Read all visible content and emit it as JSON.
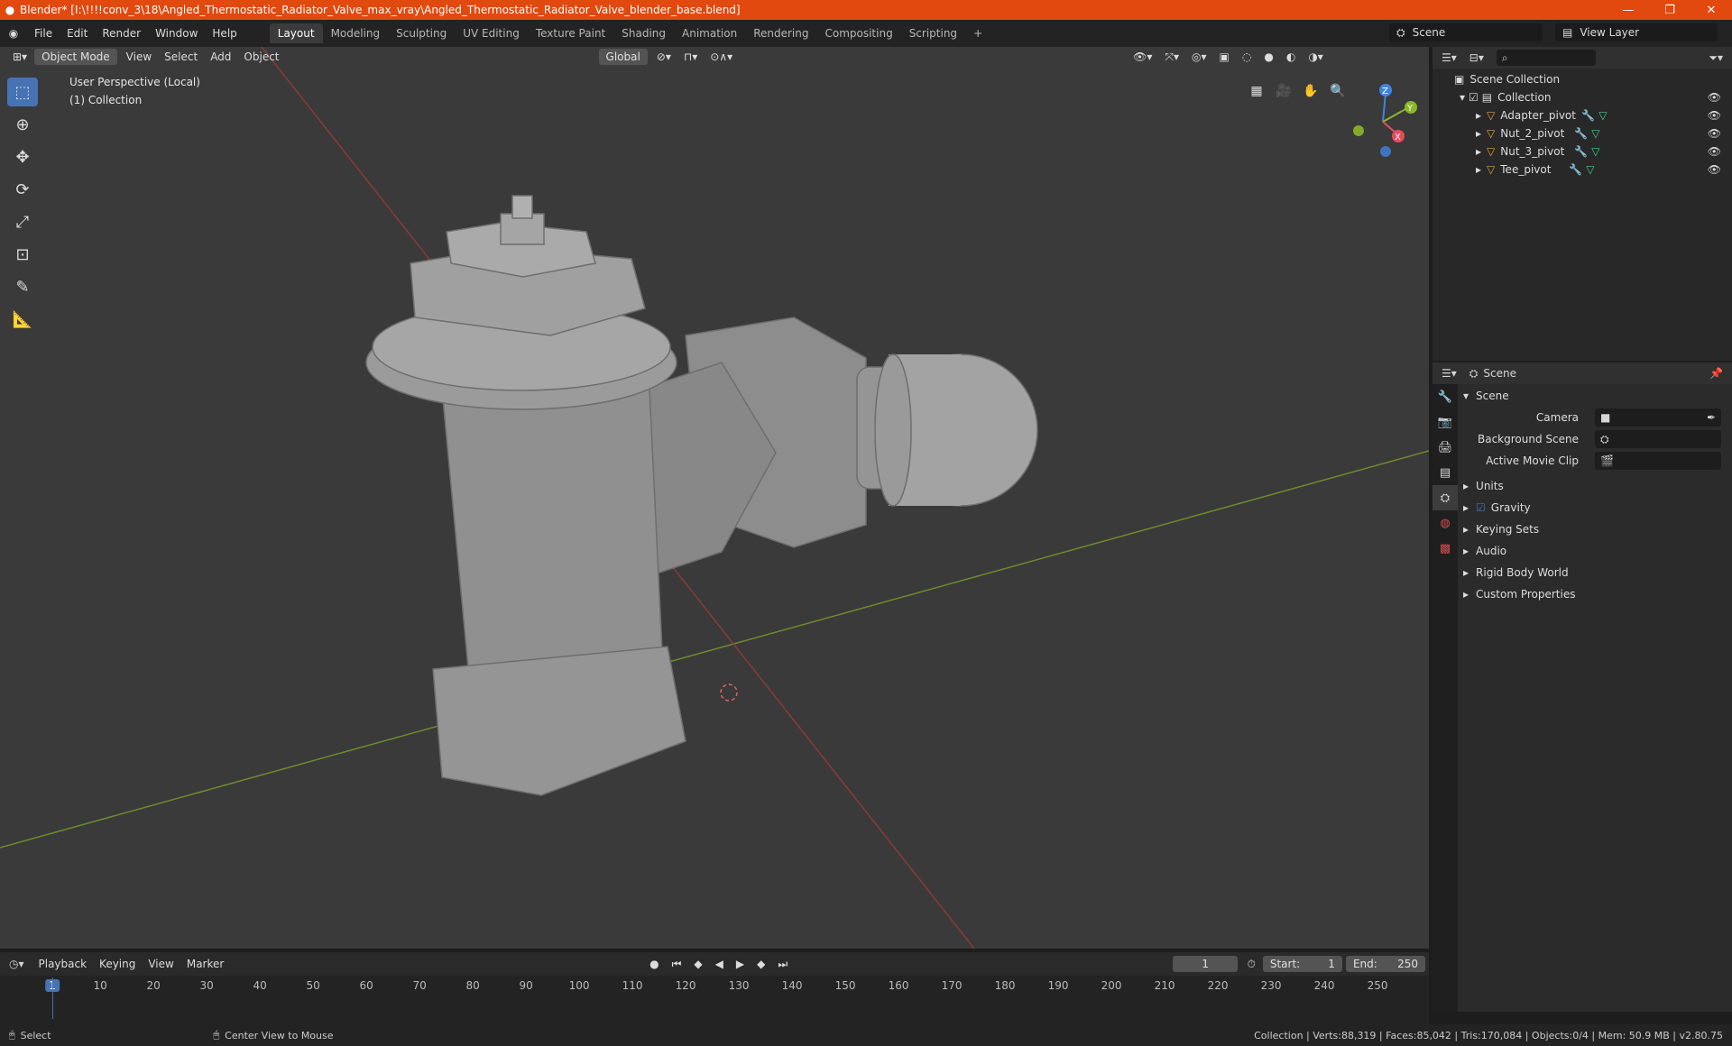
{
  "title": "Blender* [I:\\!!!!conv_3\\18\\Angled_Thermostatic_Radiator_Valve_max_vray\\Angled_Thermostatic_Radiator_Valve_blender_base.blend]",
  "window_controls": {
    "minimize": "—",
    "restore": "❐",
    "close": "✕"
  },
  "menus": [
    "File",
    "Edit",
    "Render",
    "Window",
    "Help"
  ],
  "workspaces": [
    {
      "label": "Layout",
      "active": true
    },
    {
      "label": "Modeling"
    },
    {
      "label": "Sculpting"
    },
    {
      "label": "UV Editing"
    },
    {
      "label": "Texture Paint"
    },
    {
      "label": "Shading"
    },
    {
      "label": "Animation"
    },
    {
      "label": "Rendering"
    },
    {
      "label": "Compositing"
    },
    {
      "label": "Scripting"
    }
  ],
  "add_workspace": "+",
  "scene_name": "Scene",
  "view_layer": "View Layer",
  "viewport": {
    "mode": "Object Mode",
    "menus": [
      "View",
      "Select",
      "Add",
      "Object"
    ],
    "orientation": "Global",
    "perspective": "User Perspective (Local)",
    "collection": "(1) Collection",
    "gizmo": {
      "x": "X",
      "y": "Y",
      "z": "Z"
    }
  },
  "outliner": {
    "root": "Scene Collection",
    "collection": "Collection",
    "items": [
      "Adapter_pivot",
      "Nut_2_pivot",
      "Nut_3_pivot",
      "Tee_pivot"
    ]
  },
  "properties": {
    "header": "Scene",
    "section": "Scene",
    "camera_label": "Camera",
    "background_label": "Background Scene",
    "clip_label": "Active Movie Clip",
    "panels": [
      "Units",
      "Gravity",
      "Keying Sets",
      "Audio",
      "Rigid Body World",
      "Custom Properties"
    ]
  },
  "timeline": {
    "menus": [
      "Playback",
      "Keying",
      "View",
      "Marker"
    ],
    "current_frame": "1",
    "start_label": "Start:",
    "start": "1",
    "end_label": "End:",
    "end": "250",
    "ticks": [
      "1",
      "10",
      "20",
      "30",
      "40",
      "50",
      "60",
      "70",
      "80",
      "90",
      "100",
      "110",
      "120",
      "130",
      "140",
      "150",
      "160",
      "170",
      "180",
      "190",
      "200",
      "210",
      "220",
      "230",
      "240",
      "250"
    ]
  },
  "status": {
    "select": "Select",
    "center": "Center View to Mouse",
    "stats": "Collection | Verts:88,319 | Faces:85,042 | Tris:170,084 | Objects:0/4 | Mem: 50.9 MB | v2.80.75"
  },
  "colors": {
    "accent": "#4772b3",
    "titlebar": "#e2490f",
    "x_axis": "#e74c5c",
    "y_axis": "#8ab826",
    "z_axis": "#3d85e0"
  }
}
